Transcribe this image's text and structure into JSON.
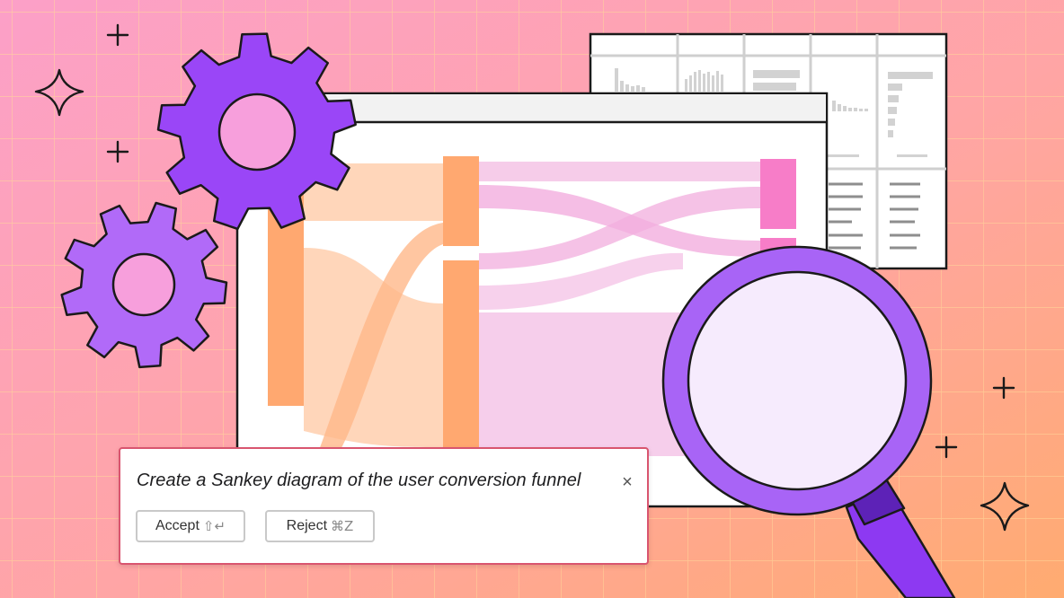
{
  "prompt": {
    "text": "Create a Sankey diagram of the user conversion funnel",
    "close_label": "×",
    "accept_label": "Accept",
    "accept_shortcut": "⇧↵",
    "reject_label": "Reject",
    "reject_shortcut": "⌘Z"
  },
  "colors": {
    "background_start": "#fca0c8",
    "background_end": "#ffab70",
    "gear": "#9a46f7",
    "gear_center": "#f79fdc",
    "node_orange": "#ffa870",
    "node_pink": "#f77dc8",
    "flow_orange": "#ffcfae",
    "flow_pink": "#f5c6e7",
    "magnifier_ring": "#a864f6",
    "magnifier_lens": "#f6ebfd",
    "outline": "#1a1a1a"
  },
  "icons": [
    "gear-icon",
    "sparkle-icon",
    "plus-icon",
    "magnifier-icon",
    "sankey-diagram",
    "data-table"
  ]
}
